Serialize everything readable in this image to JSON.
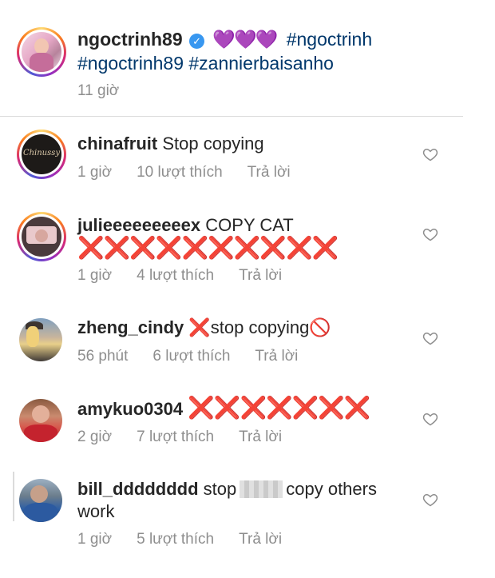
{
  "post": {
    "username": "ngoctrinh89",
    "hearts": "💜💜💜",
    "tags_line1": "#ngoctrinh",
    "tags_line2": "#ngoctrinh89 #zannierbaisanho",
    "time": "11 giờ"
  },
  "comments": [
    {
      "username": "chinafruit",
      "text": "Stop copying",
      "time": "1 giờ",
      "likes": "10 lượt thích",
      "reply": "Trả lời"
    },
    {
      "username": "julieeeeeeeeex",
      "text": "COPY CAT",
      "marks": "❌❌❌❌❌❌❌❌❌❌",
      "time": "1 giờ",
      "likes": "4 lượt thích",
      "reply": "Trả lời"
    },
    {
      "username": "zheng_cindy",
      "mark": "❌",
      "text": "stop copying",
      "end_mark": "🚫",
      "time": "56 phút",
      "likes": "6 lượt thích",
      "reply": "Trả lời"
    },
    {
      "username": "amykuo0304",
      "marks": "❌❌❌❌❌❌❌",
      "time": "2 giờ",
      "likes": "7 lượt thích",
      "reply": "Trả lời"
    },
    {
      "username": "bill_dddddddd",
      "text_before": "stop",
      "text_after": "copy others",
      "text_line2": "work",
      "time": "1 giờ",
      "likes": "5 lượt thích",
      "reply": "Trả lời"
    }
  ],
  "icons": {
    "like": "heart-outline-icon",
    "verified": "verified-badge-icon"
  },
  "colors": {
    "meta": "#8e8e8e",
    "hashtag": "#00376b",
    "verified": "#3897f0",
    "mark": "#e01b24"
  }
}
